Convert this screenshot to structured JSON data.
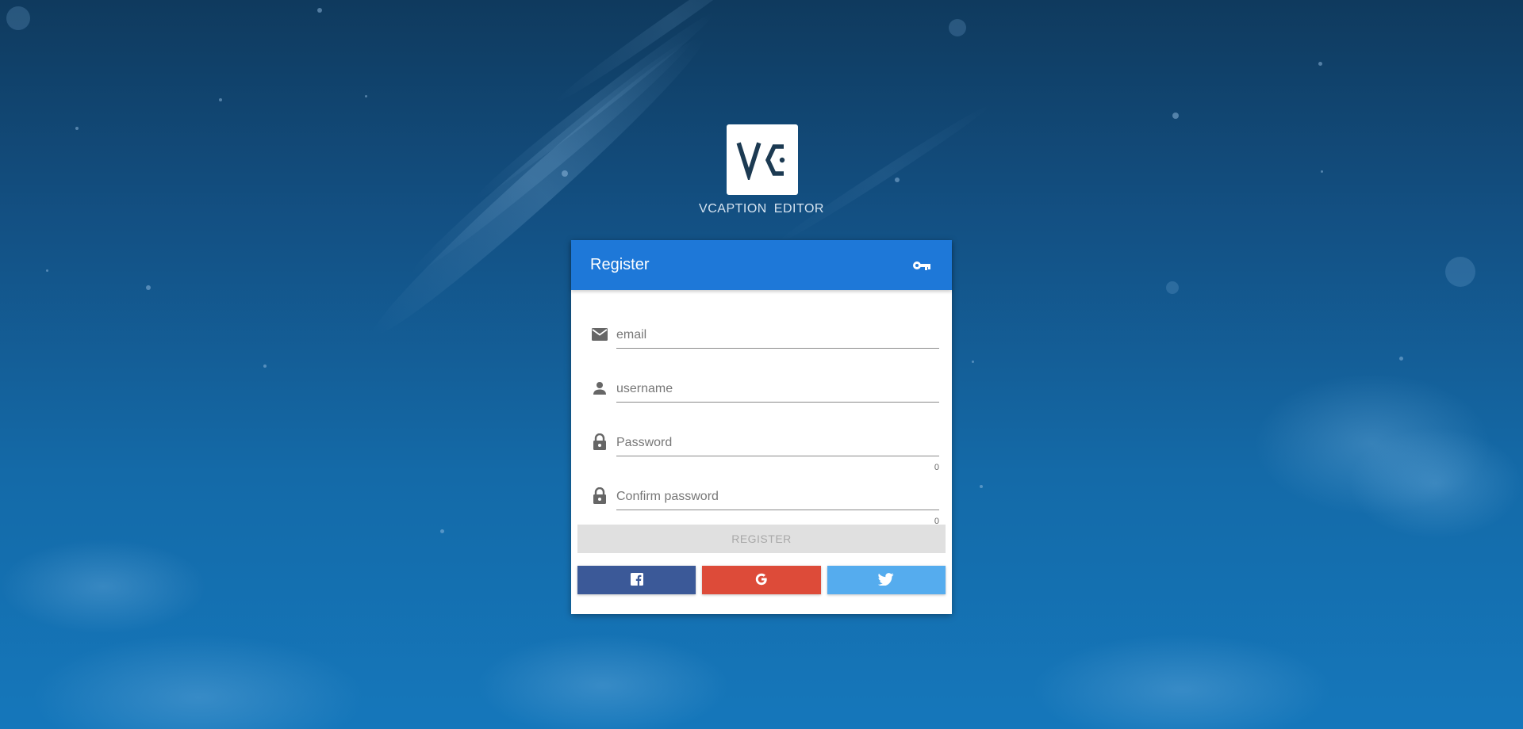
{
  "app": {
    "name": "VCAPTION EDITOR",
    "logo_text": "VE"
  },
  "card": {
    "title": "Register",
    "header_icon": "key-icon"
  },
  "form": {
    "fields": [
      {
        "icon": "email-icon",
        "placeholder": "email",
        "value": ""
      },
      {
        "icon": "person-icon",
        "placeholder": "username",
        "value": ""
      },
      {
        "icon": "lock-icon",
        "placeholder": "Password",
        "value": "",
        "counter": "0"
      },
      {
        "icon": "lock-icon",
        "placeholder": "Confirm password",
        "value": "",
        "counter": "0"
      }
    ],
    "register_label": "REGISTER"
  },
  "social": [
    {
      "name": "facebook",
      "icon": "facebook-icon",
      "color": "#3b5998"
    },
    {
      "name": "google",
      "icon": "google-icon",
      "color": "#dd4b39"
    },
    {
      "name": "twitter",
      "icon": "twitter-icon",
      "color": "#55acee"
    }
  ],
  "colors": {
    "header": "#1e78d8",
    "background_top": "#0f3a5e",
    "background_bottom": "#1577bb",
    "register_disabled": "#e0e0e0"
  }
}
